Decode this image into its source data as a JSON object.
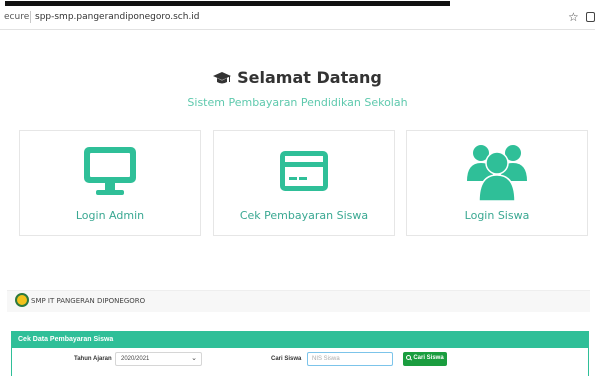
{
  "browser": {
    "security_label": "ecure",
    "url": "spp-smp.pangerandiponegoro.sch.id",
    "bookmark_glyph": "☆"
  },
  "welcome": {
    "title": "Selamat Datang",
    "subtitle": "Sistem Pembayaran Pendidikan Sekolah",
    "icon": "graduation-cap-icon"
  },
  "cards": [
    {
      "label": "Login Admin",
      "icon": "monitor-icon"
    },
    {
      "label": "Cek Pembayaran Siswa",
      "icon": "credit-card-icon"
    },
    {
      "label": "Login Siswa",
      "icon": "users-icon"
    }
  ],
  "school": {
    "name": "SMP IT PANGERAN DIPONEGORO"
  },
  "panel": {
    "title": "Cek Data Pembayaran Siswa",
    "tahun_label": "Tahun Ajaran",
    "tahun_value": "2020/2021",
    "cari_label": "Cari Siswa",
    "search_placeholder": "NIS Siswa",
    "button_label": "Cari Siswa"
  },
  "colors": {
    "accent": "#2fbf98",
    "button": "#1a9d3f",
    "subtitle": "#5ec9ad"
  }
}
